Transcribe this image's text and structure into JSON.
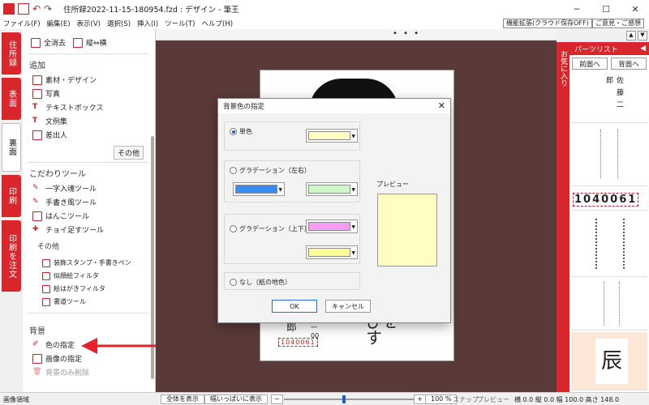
{
  "window": {
    "title": "住所録2022-11-15-180954.fzd : デザイン - 筆王"
  },
  "menu": [
    "ファイル(F)",
    "編集(E)",
    "表示(V)",
    "選択(S)",
    "挿入(I)",
    "ツール(T)",
    "ヘルプ(H)"
  ],
  "top_buttons": {
    "feature": "機能拡張(クラウド保存OFF)",
    "feedback": "ご意見・ご感想"
  },
  "left_tabs": [
    "住所録",
    "表面",
    "裏面",
    "印刷",
    "印刷を注文"
  ],
  "left_panel": {
    "top_items": {
      "clear_all": "全消去",
      "orient": "縦⇔横"
    },
    "add": {
      "title": "追加",
      "items": [
        "素材・デザイン",
        "写真",
        "テキストボックス",
        "文例集",
        "差出人"
      ],
      "other": "その他"
    },
    "kodawari": {
      "title": "こだわりツール",
      "items": [
        "一字入魂ツール",
        "手書き風ツール",
        "はんこツール",
        "チョイ足すツール"
      ],
      "other_label": "その他",
      "other_items": [
        "装飾スタンプ・手書きペン",
        "似顔絵フィルタ",
        "絵はがきフィルタ",
        "書道ツール"
      ]
    },
    "background": {
      "title": "背景",
      "items": [
        "色の指定",
        "画像の指定",
        "背景のみ削除"
      ]
    }
  },
  "card": {
    "name_char": "郎",
    "postal": "1040061",
    "big_chars": "びを\nす"
  },
  "dialog": {
    "title": "背景色の指定",
    "options": {
      "solid": "単色",
      "grad_lr": "グラデーション（左右）",
      "grad_tb": "グラデーション（上下）",
      "none": "なし（紙の地色）"
    },
    "preview_label": "プレビュー",
    "ok": "OK",
    "cancel": "キャンセル",
    "colors": {
      "solid": "#fffdc2",
      "grad_lr_1": "#3390f2",
      "grad_lr_2": "#cff7c8",
      "grad_tb_1": "#f79cf0",
      "grad_tb_2": "#fdfd96",
      "preview": "#fffdc2"
    }
  },
  "parts": {
    "side_label": "お気に入り",
    "title": "パーツリスト",
    "front_btn": "前面へ",
    "back_btn": "背面へ",
    "thumb1_text": "佐藤二郎",
    "postal": "1040061",
    "chinese_char": "辰"
  },
  "status": {
    "mode": "画像領域",
    "show_all": "全体を表示",
    "fit_width": "幅いっぱいに表示",
    "zoom": "100 %",
    "snap": "スナップ",
    "preview": "プレビュー",
    "coords": "横 0.0 縦 0.0 幅 100.0 高さ 148.0"
  }
}
